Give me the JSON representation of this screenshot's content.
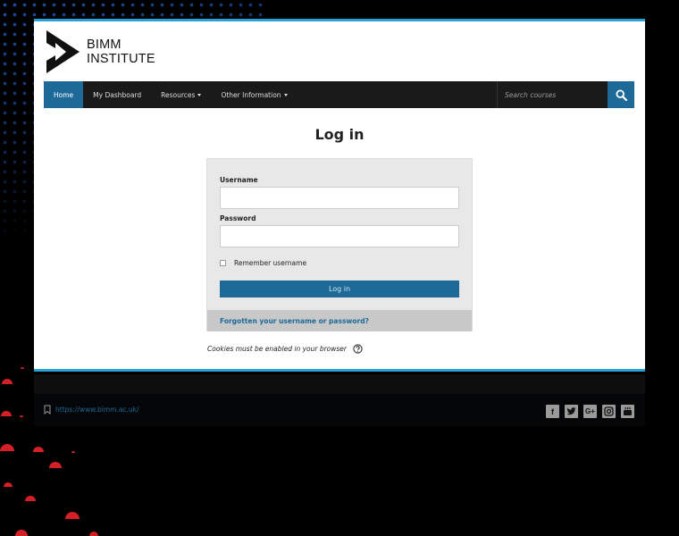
{
  "brand": {
    "line1": "BIMM",
    "line2": "INSTITUTE"
  },
  "nav": {
    "items": [
      {
        "label": "Home",
        "active": true,
        "dropdown": false
      },
      {
        "label": "My Dashboard",
        "active": false,
        "dropdown": false
      },
      {
        "label": "Resources",
        "active": false,
        "dropdown": true
      },
      {
        "label": "Other Information",
        "active": false,
        "dropdown": true
      }
    ],
    "search_placeholder": "Search courses",
    "search_icon": "search-icon"
  },
  "login": {
    "title": "Log in",
    "username_label": "Username",
    "username_value": "",
    "password_label": "Password",
    "password_value": "",
    "remember_label": "Remember username",
    "remember_checked": false,
    "submit_label": "Log in",
    "forgot_label": "Forgotten your username or password?",
    "cookies_text": "Cookies must be enabled in your browser"
  },
  "footer": {
    "link_text": "https://www.bimm.ac.uk/",
    "social": [
      "facebook-icon",
      "twitter-icon",
      "google-plus-icon",
      "instagram-icon",
      "youtube-icon"
    ]
  },
  "colors": {
    "accent": "#1d6a99",
    "top_border": "#29a3d6",
    "navbar": "#1a1a1a"
  }
}
